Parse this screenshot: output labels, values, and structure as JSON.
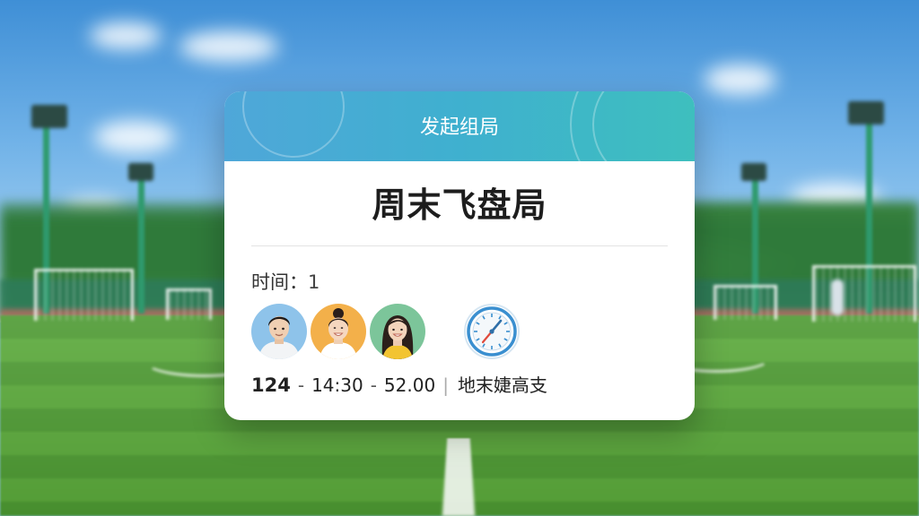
{
  "card": {
    "header_title": "发起组局",
    "event_title": "周末飞盘局",
    "time_label": "时间：",
    "time_value": "1",
    "avatars": [
      "avatar-man",
      "avatar-woman-bun",
      "avatar-woman-long-hair"
    ],
    "clock_icon": "clock-icon",
    "info": {
      "count": "124",
      "dash1": "-",
      "time": "14:30",
      "dash2": "-",
      "price_main": "52",
      "price_decimal": ".00",
      "separator": "|",
      "location": "地末婕高支"
    }
  },
  "colors": {
    "header_gradient_start": "#4fa7d9",
    "header_gradient_end": "#3ebfbe",
    "card_background": "#ffffff",
    "clock_accent": "#3a8fd0"
  }
}
